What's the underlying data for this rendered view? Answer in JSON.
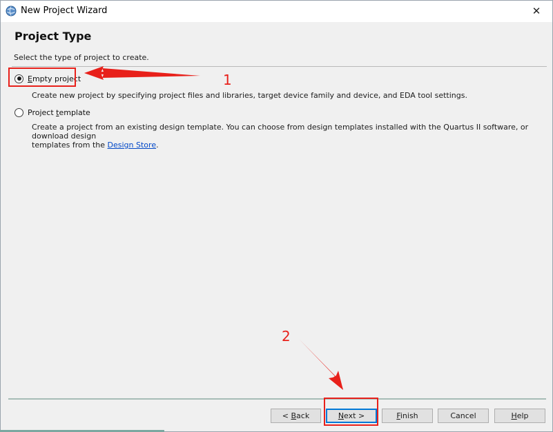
{
  "window": {
    "title": "New Project Wizard",
    "close_glyph": "✕"
  },
  "page": {
    "title": "Project Type",
    "subtitle": "Select the type of project to create."
  },
  "options": [
    {
      "label_pre": "",
      "label_u": "E",
      "label_post": "mpty project",
      "selected": true,
      "description": "Create new project by specifying project files and libraries, target device family and device, and EDA tool settings."
    },
    {
      "label_pre": "Project ",
      "label_u": "t",
      "label_post": "emplate",
      "selected": false,
      "description_1": "Create a project from an existing design template. You can choose from design templates installed with the Quartus II software, or download design",
      "description_2_pre": "templates from the ",
      "description_2_link": "Design Store",
      "description_2_post": "."
    }
  ],
  "buttons": {
    "back_pre": "< ",
    "back_u": "B",
    "back_post": "ack",
    "next_u": "N",
    "next_post": "ext >",
    "finish_u": "F",
    "finish_post": "inish",
    "cancel": "Cancel",
    "help_u": "H",
    "help_post": "elp"
  },
  "annotations": {
    "marker_1": "1",
    "marker_2": "2",
    "color": "#e8201a"
  },
  "icons": {
    "app": "quartus-globe-icon",
    "close": "close-icon"
  }
}
